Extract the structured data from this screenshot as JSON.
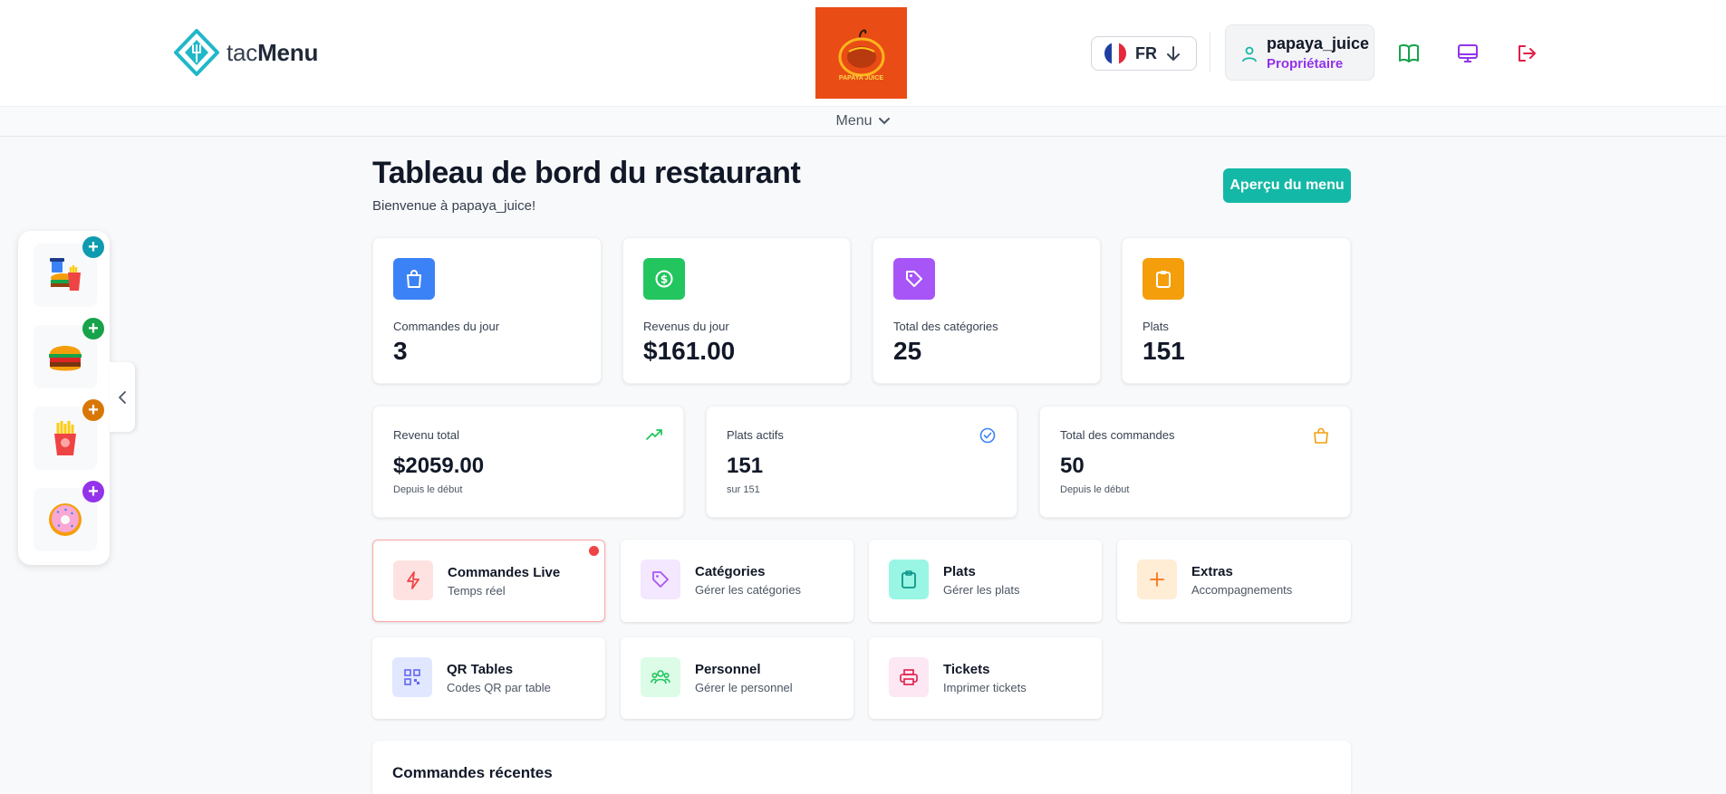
{
  "header": {
    "logo": {
      "prefix": "tac",
      "suffix": "Menu"
    },
    "brand_logo_text": "PAPAYA JUICE",
    "language": {
      "code": "FR"
    },
    "user": {
      "name": "papaya_juice",
      "role": "Propriétaire"
    },
    "icons": [
      "book-open-icon",
      "monitor-icon",
      "logout-icon"
    ]
  },
  "menu_strip": {
    "label": "Menu"
  },
  "page": {
    "title": "Tableau de bord du restaurant",
    "subtitle": "Bienvenue à papaya_juice!",
    "preview_button": "Aperçu du menu"
  },
  "stats": [
    {
      "label": "Commandes du jour",
      "value": "3",
      "icon": "shopping-bag-icon",
      "color": "#3b82f6"
    },
    {
      "label": "Revenus du jour",
      "value": "$161.00",
      "icon": "dollar-circle-icon",
      "color": "#22c55e"
    },
    {
      "label": "Total des catégories",
      "value": "25",
      "icon": "tag-icon",
      "color": "#a855f7"
    },
    {
      "label": "Plats",
      "value": "151",
      "icon": "clipboard-icon",
      "color": "#f59e0b"
    }
  ],
  "summary": [
    {
      "label": "Revenu total",
      "value": "$2059.00",
      "sub": "Depuis le début",
      "icon": "trending-up-icon",
      "color": "#22c55e"
    },
    {
      "label": "Plats actifs",
      "value": "151",
      "sub": "sur 151",
      "icon": "check-circle-icon",
      "color": "#3b82f6"
    },
    {
      "label": "Total des commandes",
      "value": "50",
      "sub": "Depuis le début",
      "icon": "shopping-bag-icon",
      "color": "#f59e0b"
    }
  ],
  "actions": [
    {
      "title": "Commandes Live",
      "sub": "Temps réel",
      "icon": "lightning-icon",
      "bg": "#fee2e2",
      "fg": "#ef4444"
    },
    {
      "title": "Catégories",
      "sub": "Gérer les catégories",
      "icon": "tag-icon",
      "bg": "#f3e8ff",
      "fg": "#a855f7"
    },
    {
      "title": "Plats",
      "sub": "Gérer les plats",
      "icon": "clipboard-icon",
      "bg": "#99f6e4",
      "fg": "#0d9488"
    },
    {
      "title": "Extras",
      "sub": "Accompagnements",
      "icon": "plus-icon",
      "bg": "#ffedd5",
      "fg": "#f97316"
    },
    {
      "title": "QR Tables",
      "sub": "Codes QR par table",
      "icon": "qr-code-icon",
      "bg": "#e0e7ff",
      "fg": "#6366f1"
    },
    {
      "title": "Personnel",
      "sub": "Gérer le personnel",
      "icon": "users-icon",
      "bg": "#dcfce7",
      "fg": "#22c55e"
    },
    {
      "title": "Tickets",
      "sub": "Imprimer tickets",
      "icon": "printer-icon",
      "bg": "#fce7f3",
      "fg": "#ec4899"
    }
  ],
  "recent": {
    "title": "Commandes récentes"
  },
  "sidebar": {
    "items": [
      {
        "name": "combo-meal-icon",
        "plus_color": "#0e9bb0"
      },
      {
        "name": "burger-icon",
        "plus_color": "#16a34a"
      },
      {
        "name": "fries-icon",
        "plus_color": "#d97706"
      },
      {
        "name": "donut-icon",
        "plus_color": "#9333ea"
      }
    ]
  }
}
